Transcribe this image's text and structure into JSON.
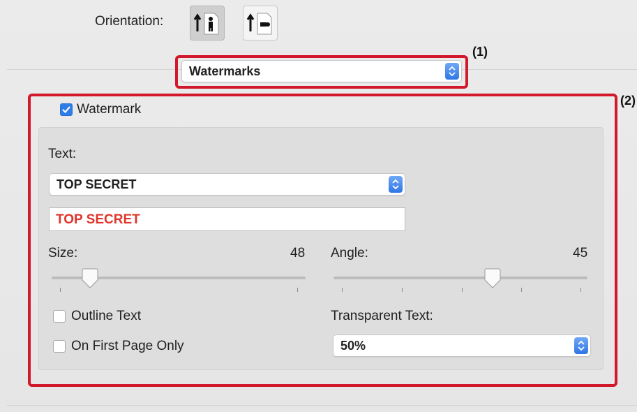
{
  "orientation": {
    "label": "Orientation:",
    "options": [
      {
        "name": "portrait",
        "selected": true
      },
      {
        "name": "landscape",
        "selected": false
      }
    ]
  },
  "panel_selector": {
    "value": "Watermarks"
  },
  "callouts": {
    "one": "(1)",
    "two": "(2)"
  },
  "watermark": {
    "checkbox_label": "Watermark",
    "checked": true,
    "text_label": "Text:",
    "text_preset": "TOP SECRET",
    "text_value": "TOP SECRET",
    "text_color": "#e0352b",
    "size": {
      "label": "Size:",
      "value": "48",
      "slider_fraction": 0.15
    },
    "angle": {
      "label": "Angle:",
      "value": "45",
      "slider_fraction": 0.625
    },
    "outline_text": {
      "label": "Outline Text",
      "checked": false
    },
    "first_page_only": {
      "label": "On First Page Only",
      "checked": false
    },
    "transparent": {
      "label": "Transparent Text:",
      "value": "50%"
    }
  },
  "colors": {
    "highlight": "#d2182b",
    "accent": "#2f7de8"
  }
}
